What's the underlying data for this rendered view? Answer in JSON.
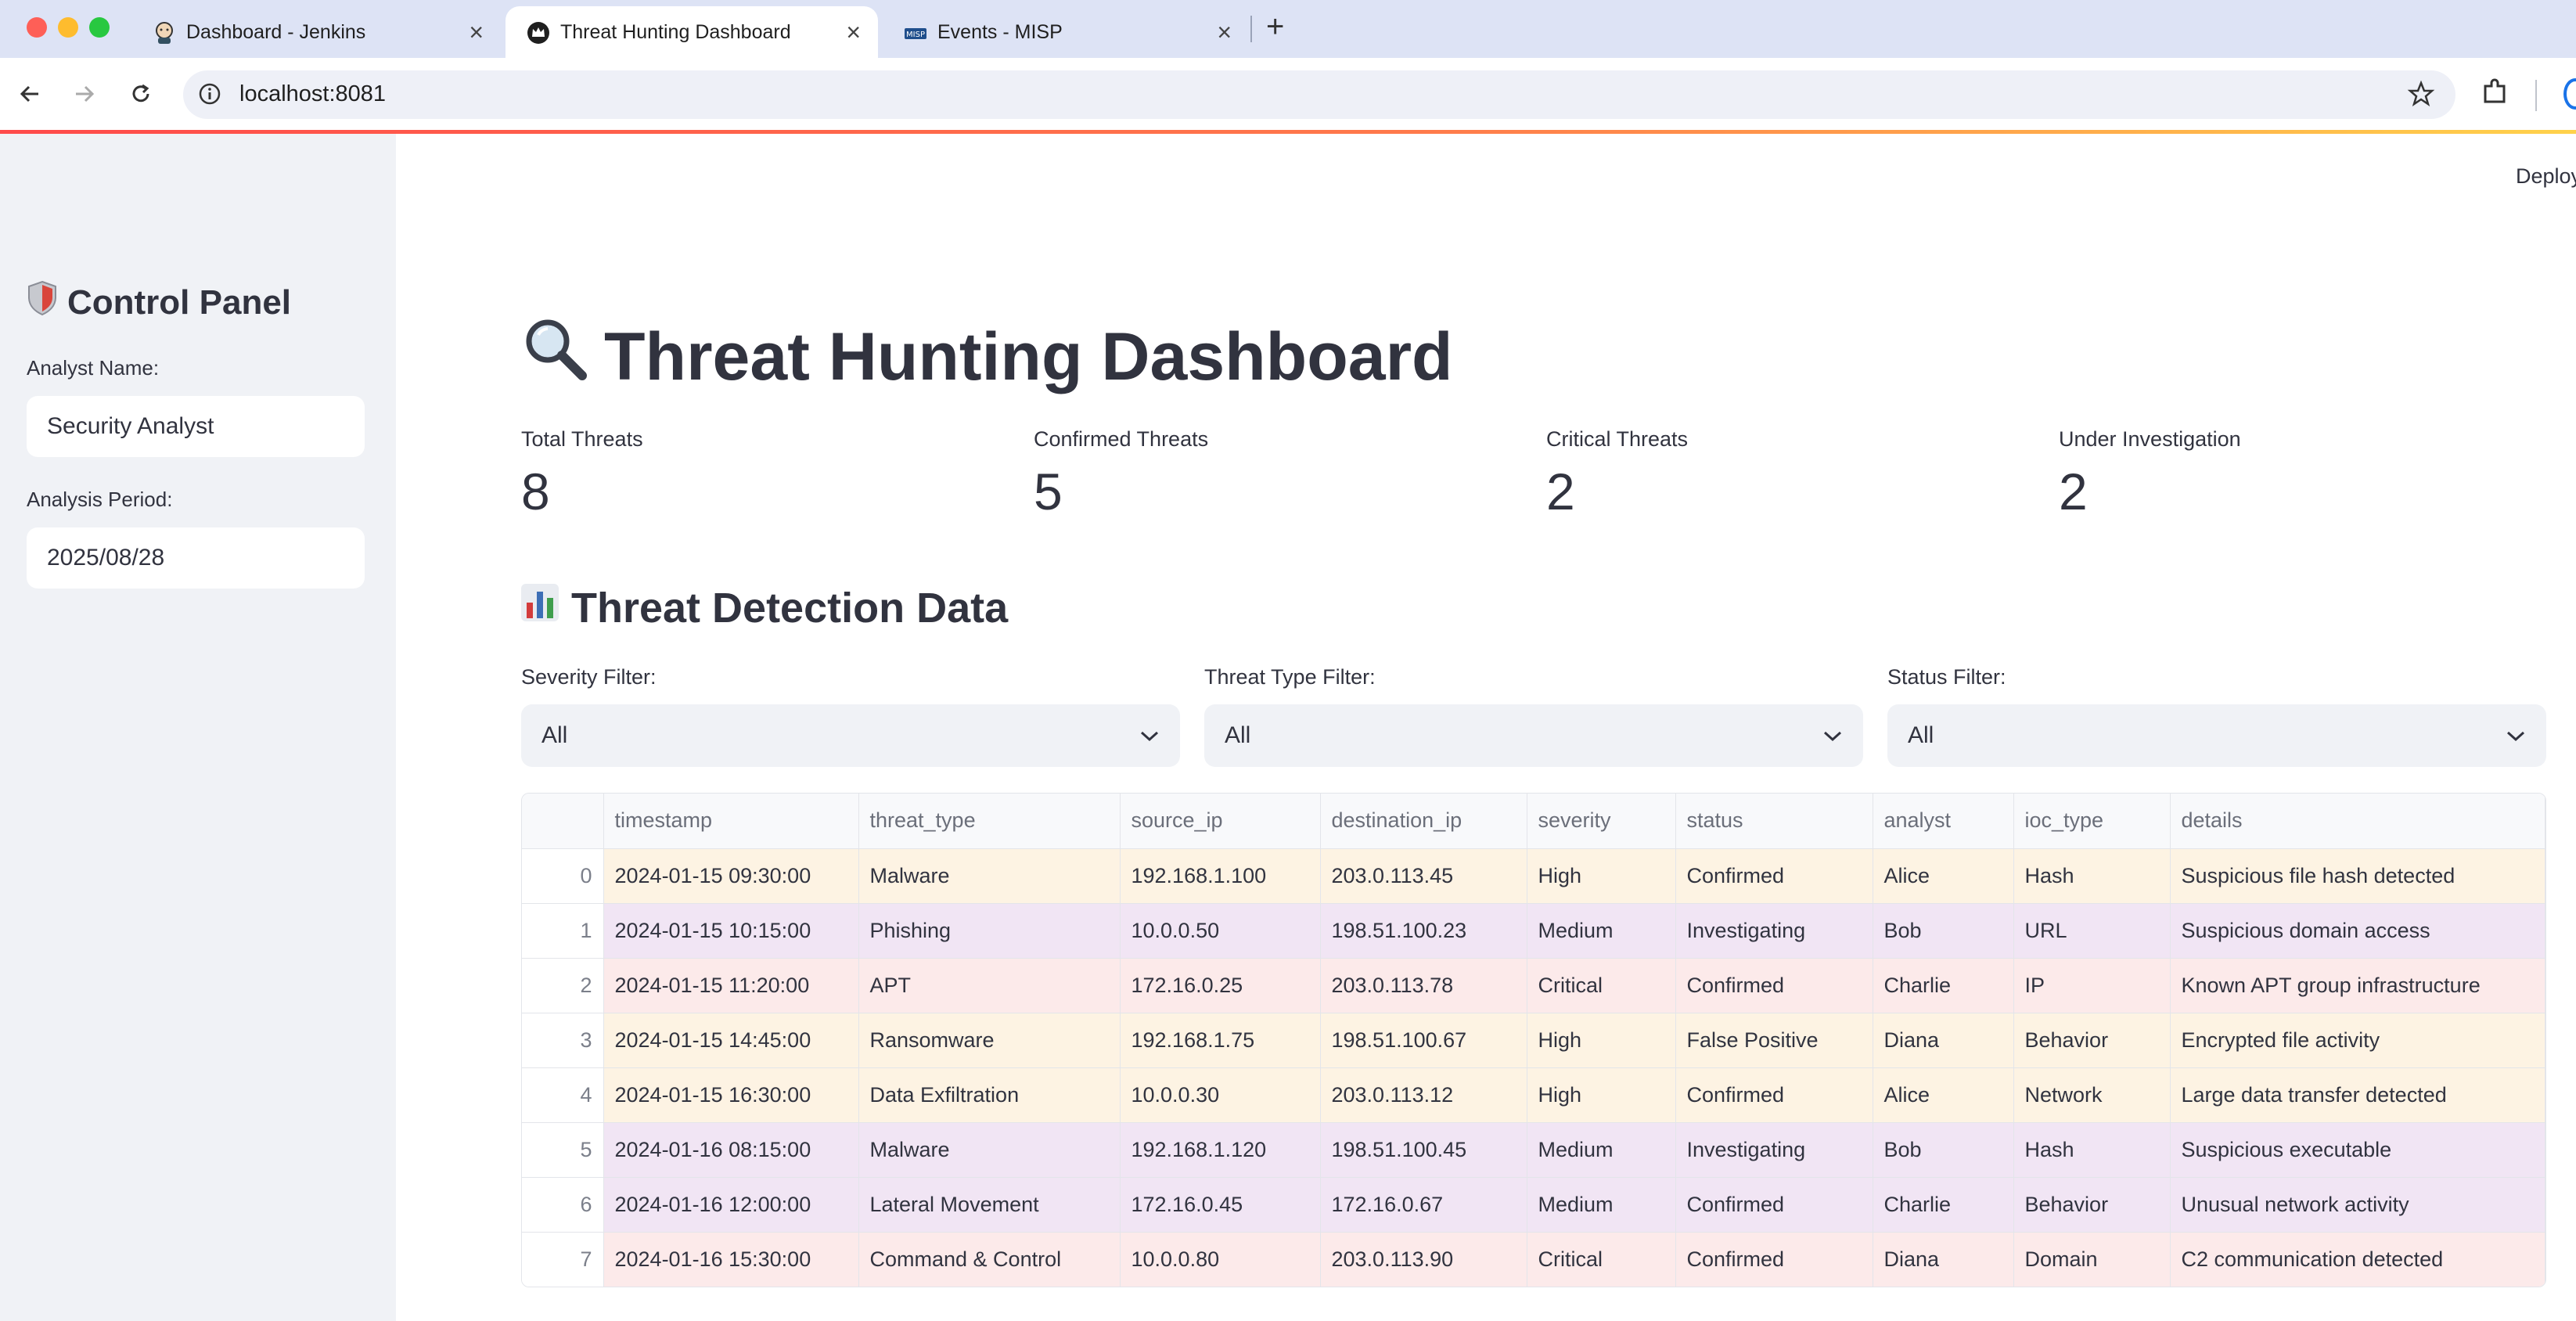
{
  "browser": {
    "tabs": [
      {
        "title": "Dashboard - Jenkins",
        "icon": "jenkins-icon",
        "active": false
      },
      {
        "title": "Threat Hunting Dashboard",
        "icon": "streamlit-crown-icon",
        "active": true
      },
      {
        "title": "Events - MISP",
        "icon": "misp-icon",
        "active": false
      }
    ],
    "url": "localhost:8081"
  },
  "app": {
    "deploy_label": "Deploy",
    "accent_colors": {
      "top_line": "#ff4b4b",
      "high": "#fdf3e3",
      "medium": "#f1e5f4",
      "critical": "#fceaea"
    }
  },
  "sidebar": {
    "title": "Control Panel",
    "title_icon": "shield-icon",
    "analyst_label": "Analyst Name:",
    "analyst_value": "Security Analyst",
    "period_label": "Analysis Period:",
    "period_value": "2025/08/28"
  },
  "main": {
    "title": "Threat Hunting Dashboard",
    "title_icon": "magnifier-icon",
    "metrics": [
      {
        "label": "Total Threats",
        "value": "8"
      },
      {
        "label": "Confirmed Threats",
        "value": "5"
      },
      {
        "label": "Critical Threats",
        "value": "2"
      },
      {
        "label": "Under Investigation",
        "value": "2"
      }
    ],
    "section_title": "Threat Detection Data",
    "section_icon": "bar-chart-icon",
    "filters": [
      {
        "label": "Severity Filter:",
        "value": "All"
      },
      {
        "label": "Threat Type Filter:",
        "value": "All"
      },
      {
        "label": "Status Filter:",
        "value": "All"
      }
    ],
    "table": {
      "columns": [
        "timestamp",
        "threat_type",
        "source_ip",
        "destination_ip",
        "severity",
        "status",
        "analyst",
        "ioc_type",
        "details"
      ],
      "rows": [
        {
          "idx": "0",
          "timestamp": "2024-01-15 09:30:00",
          "threat_type": "Malware",
          "source_ip": "192.168.1.100",
          "destination_ip": "203.0.113.45",
          "severity": "High",
          "status": "Confirmed",
          "analyst": "Alice",
          "ioc_type": "Hash",
          "details": "Suspicious file hash detected"
        },
        {
          "idx": "1",
          "timestamp": "2024-01-15 10:15:00",
          "threat_type": "Phishing",
          "source_ip": "10.0.0.50",
          "destination_ip": "198.51.100.23",
          "severity": "Medium",
          "status": "Investigating",
          "analyst": "Bob",
          "ioc_type": "URL",
          "details": "Suspicious domain access"
        },
        {
          "idx": "2",
          "timestamp": "2024-01-15 11:20:00",
          "threat_type": "APT",
          "source_ip": "172.16.0.25",
          "destination_ip": "203.0.113.78",
          "severity": "Critical",
          "status": "Confirmed",
          "analyst": "Charlie",
          "ioc_type": "IP",
          "details": "Known APT group infrastructure"
        },
        {
          "idx": "3",
          "timestamp": "2024-01-15 14:45:00",
          "threat_type": "Ransomware",
          "source_ip": "192.168.1.75",
          "destination_ip": "198.51.100.67",
          "severity": "High",
          "status": "False Positive",
          "analyst": "Diana",
          "ioc_type": "Behavior",
          "details": "Encrypted file activity"
        },
        {
          "idx": "4",
          "timestamp": "2024-01-15 16:30:00",
          "threat_type": "Data Exfiltration",
          "source_ip": "10.0.0.30",
          "destination_ip": "203.0.113.12",
          "severity": "High",
          "status": "Confirmed",
          "analyst": "Alice",
          "ioc_type": "Network",
          "details": "Large data transfer detected"
        },
        {
          "idx": "5",
          "timestamp": "2024-01-16 08:15:00",
          "threat_type": "Malware",
          "source_ip": "192.168.1.120",
          "destination_ip": "198.51.100.45",
          "severity": "Medium",
          "status": "Investigating",
          "analyst": "Bob",
          "ioc_type": "Hash",
          "details": "Suspicious executable"
        },
        {
          "idx": "6",
          "timestamp": "2024-01-16 12:00:00",
          "threat_type": "Lateral Movement",
          "source_ip": "172.16.0.45",
          "destination_ip": "172.16.0.67",
          "severity": "Medium",
          "status": "Confirmed",
          "analyst": "Charlie",
          "ioc_type": "Behavior",
          "details": "Unusual network activity"
        },
        {
          "idx": "7",
          "timestamp": "2024-01-16 15:30:00",
          "threat_type": "Command & Control",
          "source_ip": "10.0.0.80",
          "destination_ip": "203.0.113.90",
          "severity": "Critical",
          "status": "Confirmed",
          "analyst": "Diana",
          "ioc_type": "Domain",
          "details": "C2 communication detected"
        }
      ]
    }
  }
}
